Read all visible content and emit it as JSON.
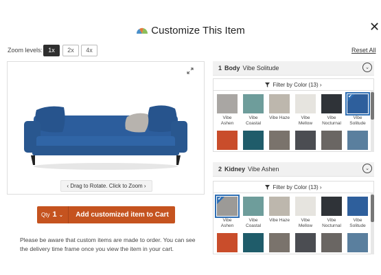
{
  "modal": {
    "title": "Customize This Item"
  },
  "zoom": {
    "label": "Zoom levels:",
    "levels": [
      "1x",
      "2x",
      "4x"
    ],
    "reset": "Reset All"
  },
  "viewer": {
    "hint": "Drag to Rotate. Click to Zoom"
  },
  "cart": {
    "qty_label": "Qty",
    "qty_value": "1",
    "add_label": "Add customized item to Cart"
  },
  "notice": "Please be aware that custom items are made to order. You can see the delivery time frame once you view the item in your cart.",
  "sections": [
    {
      "number": "1",
      "name": "Body",
      "selection": "Vibe Solitude",
      "filter": "Filter by Color (13)",
      "swatches_row1": [
        {
          "name": "Vibe Ashen",
          "color": "#a9a6a3"
        },
        {
          "name": "Vibe Coastal",
          "color": "#6e9d9b"
        },
        {
          "name": "Vibe Haze",
          "color": "#bdb7ad"
        },
        {
          "name": "Vibe Mellow",
          "color": "#e6e4df"
        },
        {
          "name": "Vibe Nocturnal",
          "color": "#2f3338"
        },
        {
          "name": "Vibe Solitude",
          "color": "#2e5f9c"
        }
      ],
      "swatches_row2": [
        {
          "color": "#c94d2b"
        },
        {
          "color": "#1f5c6a"
        },
        {
          "color": "#7a736c"
        },
        {
          "color": "#4b4d52"
        },
        {
          "color": "#6a6663"
        },
        {
          "color": "#5a7f9e"
        }
      ]
    },
    {
      "number": "2",
      "name": "Kidney",
      "selection": "Vibe Ashen",
      "filter": "Filter by Color (13)",
      "swatches_row1": [
        {
          "name": "Vibe Ashen",
          "color": "#9c9a97"
        },
        {
          "name": "Vibe Coastal",
          "color": "#6e9d9b"
        },
        {
          "name": "Vibe Haze",
          "color": "#bdb7ad"
        },
        {
          "name": "Vibe Mellow",
          "color": "#e6e4df"
        },
        {
          "name": "Vibe Nocturnal",
          "color": "#2f3338"
        },
        {
          "name": "Vibe Solitude",
          "color": "#2e5f9c"
        }
      ],
      "swatches_row2": [
        {
          "color": "#c94d2b"
        },
        {
          "color": "#1f5c6a"
        },
        {
          "color": "#7a736c"
        },
        {
          "color": "#4b4d52"
        },
        {
          "color": "#6a6663"
        },
        {
          "color": "#5a7f9e"
        }
      ]
    }
  ],
  "icons": {
    "logo": "brand-fan-logo-icon",
    "close": "close-icon",
    "expand": "expand-icon",
    "filter": "filter-funnel-icon",
    "toggle": "chevron-down-icon"
  },
  "colors": {
    "accent": "#c5531f",
    "selected_outline": "#2f6fb4",
    "sofa": "#2c5d9c"
  }
}
